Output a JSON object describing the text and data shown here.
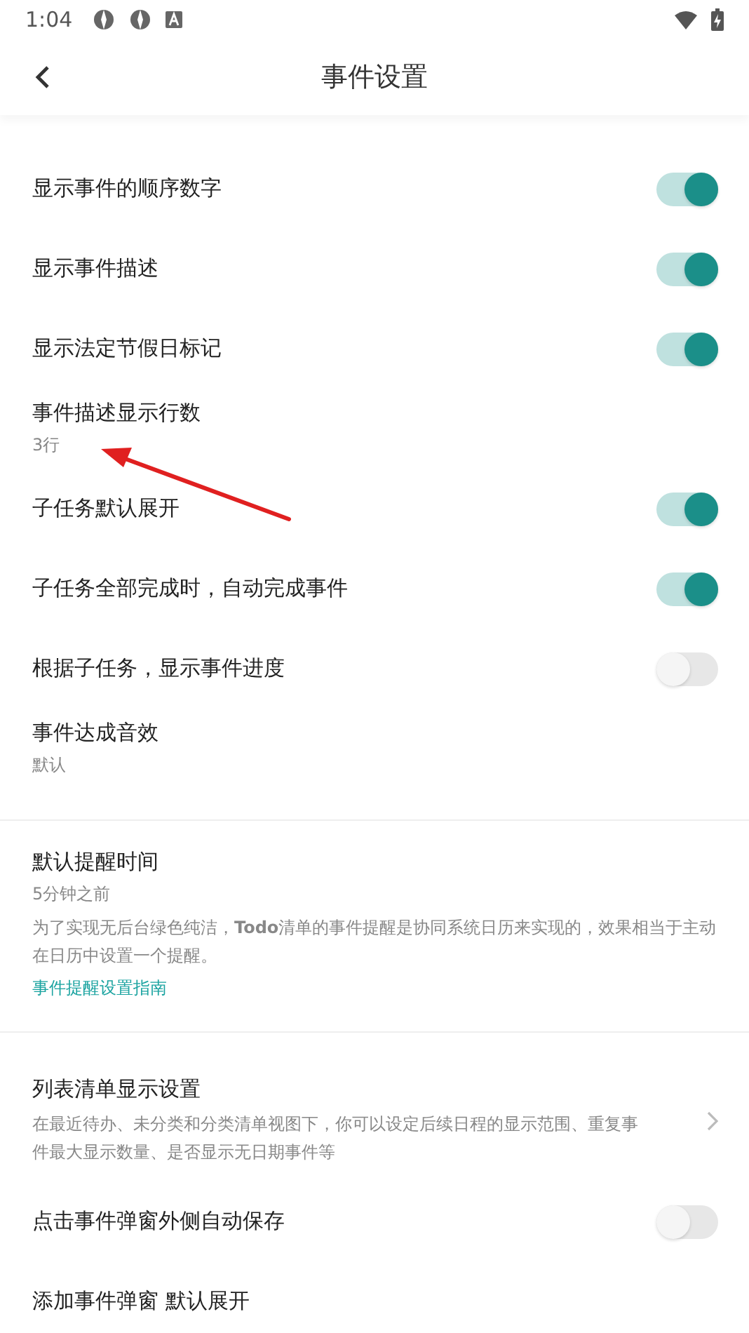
{
  "status_bar": {
    "time": "1:04"
  },
  "header": {
    "title": "事件设置"
  },
  "items": [
    {
      "kind": "toggle",
      "label": "显示事件的顺序数字",
      "on": true
    },
    {
      "kind": "toggle",
      "label": "显示事件描述",
      "on": true
    },
    {
      "kind": "toggle",
      "label": "显示法定节假日标记",
      "on": true
    },
    {
      "kind": "value",
      "label": "事件描述显示行数",
      "value": "3行"
    },
    {
      "kind": "toggle",
      "label": "子任务默认展开",
      "on": true
    },
    {
      "kind": "toggle",
      "label": "子任务全部完成时，自动完成事件",
      "on": true
    },
    {
      "kind": "toggle",
      "label": "根据子任务，显示事件进度",
      "on": false
    },
    {
      "kind": "value",
      "label": "事件达成音效",
      "value": "默认"
    },
    {
      "kind": "divider"
    },
    {
      "kind": "info",
      "label": "默认提醒时间",
      "value": "5分钟之前",
      "note": "为了实现无后台绿色纯洁，**Todo**清单的事件提醒是协同系统日历来实现的，效果相当于主动在日历中设置一个提醒。",
      "link": "事件提醒设置指南"
    },
    {
      "kind": "divider"
    },
    {
      "kind": "nav",
      "label": "列表清单显示设置",
      "note": "在最近待办、未分类和分类清单视图下，你可以设定后续日程的显示范围、重复事件最大显示数量、是否显示无日期事件等"
    },
    {
      "kind": "toggle",
      "label": "点击事件弹窗外侧自动保存",
      "on": false
    },
    {
      "kind": "plain",
      "label": "添加事件弹窗 默认展开"
    }
  ]
}
